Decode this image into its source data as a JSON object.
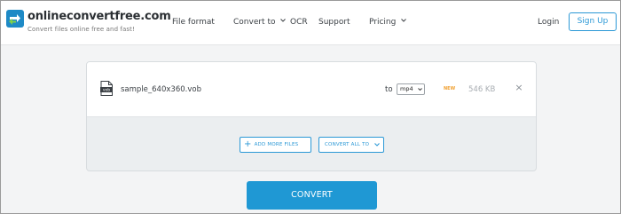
{
  "brand": {
    "name": "onlineconvertfree.com",
    "tagline": "Convert files online free and fast!",
    "logo_icon": "convert-arrows-icon",
    "accent_color": "#1e8ac6"
  },
  "nav": {
    "file_format": "File format",
    "convert_to": "Convert to",
    "ocr": "OCR",
    "support": "Support",
    "pricing": "Pricing"
  },
  "auth": {
    "login": "Login",
    "signup": "Sign Up"
  },
  "file": {
    "icon_label": "vob",
    "name": "sample_640x360.vob",
    "to_label": "to",
    "target_format": "mp4",
    "badge": "NEW",
    "size": "546 KB",
    "remove": "×"
  },
  "actions": {
    "add_more": "ADD MORE FILES",
    "convert_all": "CONVERT ALL TO",
    "convert": "CONVERT"
  }
}
